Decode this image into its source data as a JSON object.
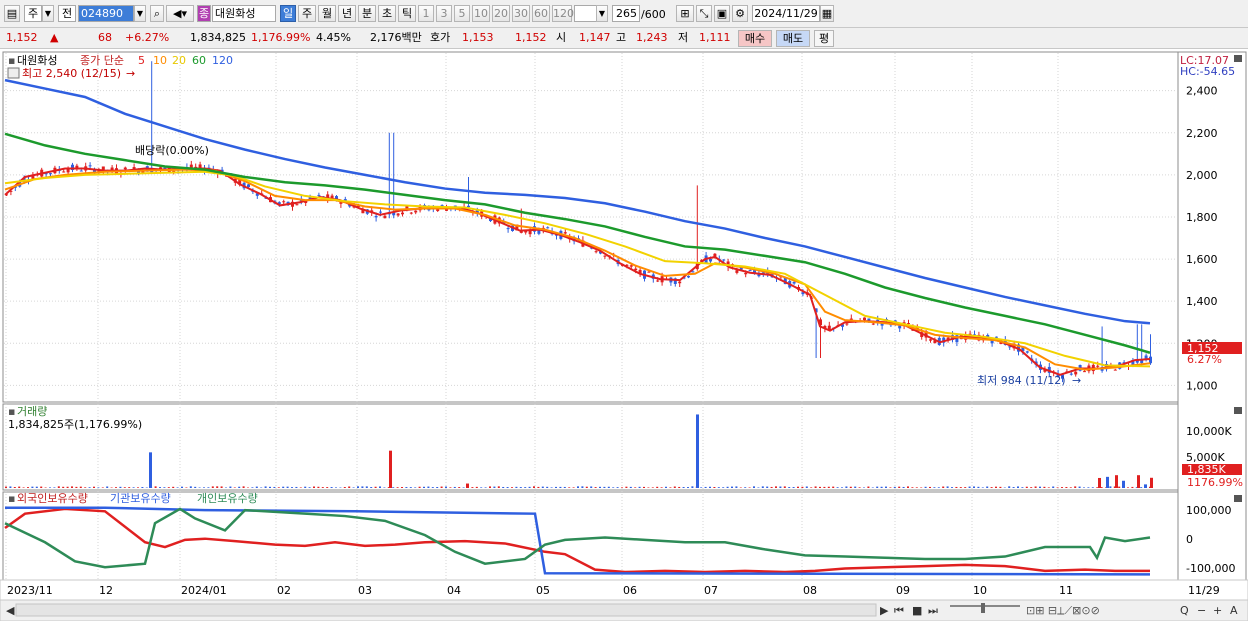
{
  "toolbar": {
    "period_type": "주",
    "prev_label": "전",
    "code": "024890",
    "mode_badge": "종",
    "stock_name": "대원화성",
    "period_tabs": [
      "일",
      "주",
      "월",
      "년",
      "분",
      "초",
      "틱"
    ],
    "interval_tabs": [
      "1",
      "3",
      "5",
      "10",
      "20",
      "30",
      "60",
      "120"
    ],
    "count_display": "265",
    "count_total": "/600",
    "date": "2024/11/29"
  },
  "quote": {
    "price": "1,152",
    "change_arrow": "▲",
    "change": "68",
    "change_pct": "+6.27%",
    "volume": "1,834,825",
    "volume_ratio": "1,176.99%",
    "turnover": "4.45%",
    "amount": "2,176백만",
    "ask_label": "호가",
    "ask": "1,153",
    "bid": "1,152",
    "open_label": "시",
    "open": "1,147",
    "high_label": "고",
    "high": "1,243",
    "low_label": "저",
    "low": "1,111",
    "buy_label": "매수",
    "sell_label": "매도",
    "eval_label": "평"
  },
  "price_panel": {
    "name": "대원화성",
    "legend_prefix": "종가 단순",
    "ma_periods": [
      "5",
      "10",
      "20",
      "60",
      "120"
    ],
    "ma_colors": [
      "#e02020",
      "#ff8c00",
      "#f2d200",
      "#1c9a2c",
      "#2f5fe0"
    ],
    "high_note": "최고 2,540 (12/15)",
    "low_note": "최저 984 (11/12)",
    "dividend_note": "배당락(0.00%)",
    "lc": "LC:17.07",
    "hc": "HC:-54.65",
    "y_ticks": [
      "2,400",
      "2,200",
      "2,000",
      "1,800",
      "1,600",
      "1,400",
      "1,200",
      "1,000"
    ],
    "price_badge": "1,152",
    "pct_badge": "6.27%"
  },
  "volume_panel": {
    "title": "거래량",
    "subtitle": "1,834,825주(1,176.99%)",
    "y_ticks": [
      "10,000K",
      "5,000K"
    ],
    "badge": "1,835K",
    "pct": "1176.99%"
  },
  "holdings_panel": {
    "legend": [
      "외국인보유수량",
      "기관보유수량",
      "개인보유수량"
    ],
    "colors": [
      "#e02020",
      "#2f5fe0",
      "#2e8b57"
    ],
    "y_ticks": [
      "100,000",
      "0",
      "-100,000"
    ]
  },
  "x_axis": [
    "2023/11",
    "12",
    "2024/01",
    "02",
    "03",
    "04",
    "05",
    "06",
    "07",
    "08",
    "09",
    "10",
    "11"
  ],
  "x_axis_end": "11/29",
  "chart_data": {
    "type": "candlestick",
    "title": "대원화성",
    "ylim": [
      940,
      2560
    ],
    "series": [
      {
        "name": "5",
        "points": [
          [
            0,
            1905
          ],
          [
            20,
            1990
          ],
          [
            40,
            2010
          ],
          [
            60,
            2030
          ],
          [
            80,
            2030
          ],
          [
            100,
            2020
          ],
          [
            120,
            2020
          ],
          [
            140,
            2030
          ],
          [
            160,
            2025
          ],
          [
            180,
            2030
          ],
          [
            200,
            2030
          ],
          [
            215,
            2020
          ],
          [
            235,
            1955
          ],
          [
            255,
            1910
          ],
          [
            275,
            1855
          ],
          [
            295,
            1870
          ],
          [
            315,
            1895
          ],
          [
            335,
            1880
          ],
          [
            355,
            1840
          ],
          [
            375,
            1810
          ],
          [
            395,
            1830
          ],
          [
            415,
            1840
          ],
          [
            435,
            1845
          ],
          [
            455,
            1845
          ],
          [
            475,
            1815
          ],
          [
            495,
            1775
          ],
          [
            515,
            1735
          ],
          [
            535,
            1740
          ],
          [
            555,
            1715
          ],
          [
            575,
            1680
          ],
          [
            595,
            1640
          ],
          [
            615,
            1580
          ],
          [
            635,
            1530
          ],
          [
            655,
            1505
          ],
          [
            675,
            1500
          ],
          [
            690,
            1560
          ],
          [
            700,
            1600
          ],
          [
            710,
            1610
          ],
          [
            725,
            1560
          ],
          [
            745,
            1535
          ],
          [
            765,
            1525
          ],
          [
            785,
            1480
          ],
          [
            805,
            1430
          ],
          [
            815,
            1280
          ],
          [
            825,
            1260
          ],
          [
            840,
            1300
          ],
          [
            860,
            1305
          ],
          [
            880,
            1300
          ],
          [
            900,
            1285
          ],
          [
            915,
            1250
          ],
          [
            935,
            1205
          ],
          [
            955,
            1230
          ],
          [
            975,
            1230
          ],
          [
            995,
            1210
          ],
          [
            1015,
            1170
          ],
          [
            1035,
            1085
          ],
          [
            1055,
            1050
          ],
          [
            1075,
            1080
          ],
          [
            1095,
            1080
          ],
          [
            1115,
            1095
          ],
          [
            1130,
            1120
          ],
          [
            1145,
            1125
          ]
        ]
      },
      {
        "name": "10",
        "points": [
          [
            0,
            1930
          ],
          [
            30,
            1980
          ],
          [
            60,
            2000
          ],
          [
            100,
            2015
          ],
          [
            140,
            2020
          ],
          [
            180,
            2025
          ],
          [
            210,
            2020
          ],
          [
            240,
            1970
          ],
          [
            270,
            1900
          ],
          [
            300,
            1880
          ],
          [
            330,
            1880
          ],
          [
            360,
            1850
          ],
          [
            390,
            1835
          ],
          [
            420,
            1840
          ],
          [
            450,
            1840
          ],
          [
            480,
            1810
          ],
          [
            510,
            1760
          ],
          [
            540,
            1740
          ],
          [
            570,
            1700
          ],
          [
            600,
            1640
          ],
          [
            630,
            1570
          ],
          [
            660,
            1520
          ],
          [
            690,
            1530
          ],
          [
            710,
            1580
          ],
          [
            740,
            1560
          ],
          [
            770,
            1530
          ],
          [
            800,
            1480
          ],
          [
            820,
            1350
          ],
          [
            840,
            1310
          ],
          [
            870,
            1300
          ],
          [
            900,
            1285
          ],
          [
            930,
            1240
          ],
          [
            960,
            1225
          ],
          [
            990,
            1215
          ],
          [
            1020,
            1180
          ],
          [
            1050,
            1100
          ],
          [
            1080,
            1075
          ],
          [
            1110,
            1085
          ],
          [
            1145,
            1105
          ]
        ]
      },
      {
        "name": "20",
        "points": [
          [
            0,
            1960
          ],
          [
            40,
            1985
          ],
          [
            80,
            2000
          ],
          [
            120,
            2005
          ],
          [
            160,
            2010
          ],
          [
            200,
            2015
          ],
          [
            230,
            1995
          ],
          [
            260,
            1945
          ],
          [
            300,
            1900
          ],
          [
            340,
            1875
          ],
          [
            380,
            1860
          ],
          [
            420,
            1850
          ],
          [
            460,
            1845
          ],
          [
            500,
            1810
          ],
          [
            540,
            1770
          ],
          [
            580,
            1720
          ],
          [
            620,
            1660
          ],
          [
            660,
            1590
          ],
          [
            700,
            1580
          ],
          [
            740,
            1565
          ],
          [
            780,
            1530
          ],
          [
            820,
            1430
          ],
          [
            860,
            1330
          ],
          [
            900,
            1290
          ],
          [
            940,
            1250
          ],
          [
            980,
            1230
          ],
          [
            1020,
            1200
          ],
          [
            1060,
            1140
          ],
          [
            1100,
            1095
          ],
          [
            1145,
            1090
          ]
        ]
      },
      {
        "name": "60",
        "points": [
          [
            0,
            2195
          ],
          [
            40,
            2140
          ],
          [
            80,
            2100
          ],
          [
            120,
            2070
          ],
          [
            160,
            2040
          ],
          [
            200,
            2025
          ],
          [
            240,
            1990
          ],
          [
            280,
            1965
          ],
          [
            320,
            1950
          ],
          [
            360,
            1930
          ],
          [
            400,
            1905
          ],
          [
            440,
            1880
          ],
          [
            480,
            1860
          ],
          [
            520,
            1820
          ],
          [
            560,
            1790
          ],
          [
            600,
            1755
          ],
          [
            640,
            1705
          ],
          [
            680,
            1660
          ],
          [
            720,
            1645
          ],
          [
            760,
            1615
          ],
          [
            800,
            1585
          ],
          [
            840,
            1530
          ],
          [
            880,
            1465
          ],
          [
            920,
            1415
          ],
          [
            960,
            1370
          ],
          [
            1000,
            1330
          ],
          [
            1040,
            1290
          ],
          [
            1080,
            1240
          ],
          [
            1120,
            1190
          ],
          [
            1145,
            1155
          ]
        ]
      },
      {
        "name": "120",
        "points": [
          [
            0,
            2450
          ],
          [
            40,
            2410
          ],
          [
            80,
            2370
          ],
          [
            120,
            2290
          ],
          [
            160,
            2230
          ],
          [
            200,
            2170
          ],
          [
            240,
            2120
          ],
          [
            280,
            2075
          ],
          [
            320,
            2035
          ],
          [
            360,
            2000
          ],
          [
            400,
            1965
          ],
          [
            440,
            1935
          ],
          [
            480,
            1915
          ],
          [
            520,
            1905
          ],
          [
            560,
            1890
          ],
          [
            600,
            1865
          ],
          [
            640,
            1825
          ],
          [
            680,
            1780
          ],
          [
            720,
            1745
          ],
          [
            760,
            1700
          ],
          [
            800,
            1660
          ],
          [
            840,
            1610
          ],
          [
            880,
            1560
          ],
          [
            920,
            1510
          ],
          [
            960,
            1465
          ],
          [
            1000,
            1420
          ],
          [
            1040,
            1380
          ],
          [
            1080,
            1340
          ],
          [
            1120,
            1305
          ],
          [
            1145,
            1295
          ]
        ]
      }
    ],
    "volume_spikes_k": [
      {
        "x": 145,
        "v": 6400,
        "color": "#2f5fe0"
      },
      {
        "x": 385,
        "v": 6700,
        "color": "#e02020"
      },
      {
        "x": 462,
        "v": 800,
        "color": "#e02020"
      },
      {
        "x": 692,
        "v": 13200,
        "color": "#2f5fe0"
      },
      {
        "x": 1094,
        "v": 1800,
        "color": "#e02020"
      },
      {
        "x": 1102,
        "v": 2000,
        "color": "#2f5fe0"
      },
      {
        "x": 1111,
        "v": 2300,
        "color": "#e02020"
      },
      {
        "x": 1118,
        "v": 1300,
        "color": "#2f5fe0"
      },
      {
        "x": 1133,
        "v": 2300,
        "color": "#e02020"
      },
      {
        "x": 1140,
        "v": 650,
        "color": "#2f5fe0"
      },
      {
        "x": 1146,
        "v": 1835,
        "color": "#e02020"
      }
    ],
    "holdings": [
      {
        "name": "외국인보유수량",
        "points": [
          [
            0,
            40000
          ],
          [
            20,
            100000
          ],
          [
            60,
            120000
          ],
          [
            100,
            110000
          ],
          [
            140,
            -20000
          ],
          [
            160,
            -40000
          ],
          [
            180,
            -10000
          ],
          [
            200,
            -5000
          ],
          [
            230,
            -15000
          ],
          [
            270,
            -30000
          ],
          [
            300,
            -35000
          ],
          [
            330,
            -20000
          ],
          [
            360,
            -35000
          ],
          [
            390,
            -30000
          ],
          [
            420,
            -20000
          ],
          [
            460,
            -15000
          ],
          [
            500,
            -25000
          ],
          [
            540,
            -60000
          ],
          [
            560,
            -70000
          ],
          [
            590,
            -135000
          ],
          [
            620,
            -145000
          ],
          [
            660,
            -140000
          ],
          [
            700,
            -145000
          ],
          [
            740,
            -140000
          ],
          [
            780,
            -145000
          ],
          [
            810,
            -140000
          ],
          [
            840,
            -130000
          ],
          [
            880,
            -125000
          ],
          [
            920,
            -120000
          ],
          [
            960,
            -115000
          ],
          [
            1000,
            -120000
          ],
          [
            1040,
            -140000
          ],
          [
            1080,
            -135000
          ],
          [
            1110,
            -140000
          ],
          [
            1145,
            -140000
          ]
        ]
      },
      {
        "name": "기관보유수량",
        "points": [
          [
            0,
            125000
          ],
          [
            100,
            125000
          ],
          [
            200,
            115000
          ],
          [
            350,
            110000
          ],
          [
            530,
            100000
          ],
          [
            540,
            -150000
          ],
          [
            1145,
            -155000
          ]
        ]
      },
      {
        "name": "개인보유수량",
        "points": [
          [
            0,
            60000
          ],
          [
            40,
            -20000
          ],
          [
            70,
            -100000
          ],
          [
            100,
            -125000
          ],
          [
            140,
            -110000
          ],
          [
            150,
            60000
          ],
          [
            175,
            120000
          ],
          [
            190,
            80000
          ],
          [
            220,
            30000
          ],
          [
            240,
            115000
          ],
          [
            300,
            100000
          ],
          [
            340,
            90000
          ],
          [
            380,
            70000
          ],
          [
            420,
            10000
          ],
          [
            450,
            -60000
          ],
          [
            480,
            -110000
          ],
          [
            520,
            -90000
          ],
          [
            540,
            -30000
          ],
          [
            560,
            -10000
          ],
          [
            600,
            0
          ],
          [
            640,
            -10000
          ],
          [
            680,
            -20000
          ],
          [
            720,
            -20000
          ],
          [
            760,
            -50000
          ],
          [
            800,
            -75000
          ],
          [
            840,
            -80000
          ],
          [
            880,
            -85000
          ],
          [
            920,
            -90000
          ],
          [
            960,
            -90000
          ],
          [
            1000,
            -80000
          ],
          [
            1040,
            -40000
          ],
          [
            1085,
            -40000
          ],
          [
            1092,
            -85000
          ],
          [
            1100,
            0
          ],
          [
            1120,
            -15000
          ],
          [
            1145,
            0
          ]
        ]
      }
    ]
  }
}
